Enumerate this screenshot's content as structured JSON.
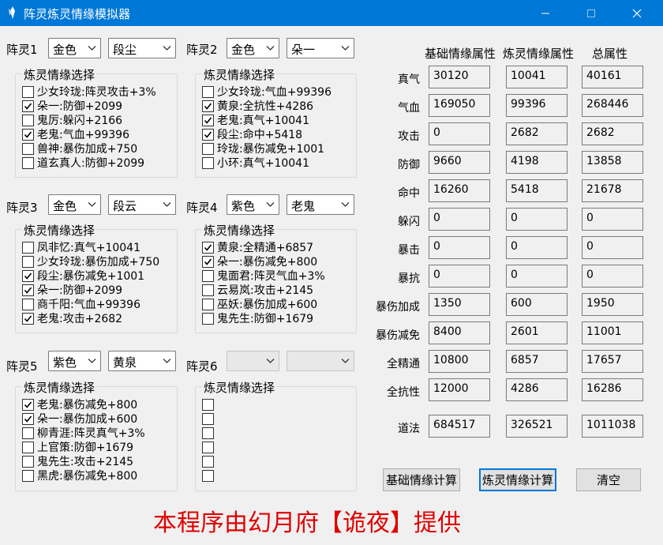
{
  "window": {
    "title": "阵灵炼灵情缘模拟器"
  },
  "spirits": [
    {
      "label": "阵灵1",
      "grade": "金色",
      "name": "段尘",
      "group_title": "炼灵情缘选择",
      "options": [
        {
          "text": "少女玲珑:阵灵攻击+3%",
          "checked": false
        },
        {
          "text": "朵一:防御+2099",
          "checked": true
        },
        {
          "text": "鬼厉:躲闪+2166",
          "checked": false
        },
        {
          "text": "老鬼:气血+99396",
          "checked": true
        },
        {
          "text": "兽神:暴伤加成+750",
          "checked": false
        },
        {
          "text": "道玄真人:防御+2099",
          "checked": false
        }
      ]
    },
    {
      "label": "阵灵2",
      "grade": "金色",
      "name": "朵一",
      "group_title": "炼灵情缘选择",
      "options": [
        {
          "text": "少女玲珑:气血+99396",
          "checked": false
        },
        {
          "text": "黄泉:全抗性+4286",
          "checked": true
        },
        {
          "text": "老鬼:真气+10041",
          "checked": true
        },
        {
          "text": "段尘:命中+5418",
          "checked": true
        },
        {
          "text": "玲珑:暴伤减免+1001",
          "checked": false
        },
        {
          "text": "小环:真气+10041",
          "checked": false
        }
      ]
    },
    {
      "label": "阵灵3",
      "grade": "金色",
      "name": "段云",
      "group_title": "炼灵情缘选择",
      "options": [
        {
          "text": "凤非忆:真气+10041",
          "checked": false
        },
        {
          "text": "少女玲珑:暴伤加成+750",
          "checked": false
        },
        {
          "text": "段尘:暴伤减免+1001",
          "checked": true
        },
        {
          "text": "朵一:防御+2099",
          "checked": true
        },
        {
          "text": "商千阳:气血+99396",
          "checked": false
        },
        {
          "text": "老鬼:攻击+2682",
          "checked": true
        }
      ]
    },
    {
      "label": "阵灵4",
      "grade": "紫色",
      "name": "老鬼",
      "group_title": "炼灵情缘选择",
      "options": [
        {
          "text": "黄泉:全精通+6857",
          "checked": true
        },
        {
          "text": "朵一:暴伤减免+800",
          "checked": true
        },
        {
          "text": "鬼面君:阵灵气血+3%",
          "checked": false
        },
        {
          "text": "云易岚:攻击+2145",
          "checked": false
        },
        {
          "text": "巫妖:暴伤加成+600",
          "checked": false
        },
        {
          "text": "鬼先生:防御+1679",
          "checked": false
        }
      ]
    },
    {
      "label": "阵灵5",
      "grade": "紫色",
      "name": "黄泉",
      "group_title": "炼灵情缘选择",
      "options": [
        {
          "text": "老鬼:暴伤减免+800",
          "checked": true
        },
        {
          "text": "朵一:暴伤加成+600",
          "checked": true
        },
        {
          "text": "柳青涯:阵灵真气+3%",
          "checked": false
        },
        {
          "text": "上官策:防御+1679",
          "checked": false
        },
        {
          "text": "鬼先生:攻击+2145",
          "checked": false
        },
        {
          "text": "黑虎:暴伤减免+800",
          "checked": false
        }
      ]
    },
    {
      "label": "阵灵6",
      "grade": "",
      "name": "",
      "group_title": "炼灵情缘选择",
      "options": [
        {
          "text": "",
          "checked": false
        },
        {
          "text": "",
          "checked": false
        },
        {
          "text": "",
          "checked": false
        },
        {
          "text": "",
          "checked": false
        },
        {
          "text": "",
          "checked": false
        },
        {
          "text": "",
          "checked": false
        }
      ]
    }
  ],
  "attributes": {
    "headers": [
      "基础情缘属性",
      "炼灵情缘属性",
      "总属性"
    ],
    "rows": [
      {
        "label": "真气",
        "base": "30120",
        "spirit": "10041",
        "total": "40161"
      },
      {
        "label": "气血",
        "base": "169050",
        "spirit": "99396",
        "total": "268446"
      },
      {
        "label": "攻击",
        "base": "0",
        "spirit": "2682",
        "total": "2682"
      },
      {
        "label": "防御",
        "base": "9660",
        "spirit": "4198",
        "total": "13858"
      },
      {
        "label": "命中",
        "base": "16260",
        "spirit": "5418",
        "total": "21678"
      },
      {
        "label": "躲闪",
        "base": "0",
        "spirit": "0",
        "total": "0"
      },
      {
        "label": "暴击",
        "base": "0",
        "spirit": "0",
        "total": "0"
      },
      {
        "label": "暴抗",
        "base": "0",
        "spirit": "0",
        "total": "0"
      },
      {
        "label": "暴伤加成",
        "base": "1350",
        "spirit": "600",
        "total": "1950"
      },
      {
        "label": "暴伤减免",
        "base": "8400",
        "spirit": "2601",
        "total": "11001"
      },
      {
        "label": "全精通",
        "base": "10800",
        "spirit": "6857",
        "total": "17657"
      },
      {
        "label": "全抗性",
        "base": "12000",
        "spirit": "4286",
        "total": "16286"
      },
      {
        "label": "道法",
        "base": "684517",
        "spirit": "326521",
        "total": "1011038"
      }
    ]
  },
  "buttons": {
    "base_calc": "基础情缘计算",
    "spirit_calc": "炼灵情缘计算",
    "clear": "清空"
  },
  "footer": "本程序由幻月府【诡夜】提供",
  "colors": {
    "titlebar": "#0078d7",
    "footer": "#e00000",
    "accent": "#0078d7"
  }
}
